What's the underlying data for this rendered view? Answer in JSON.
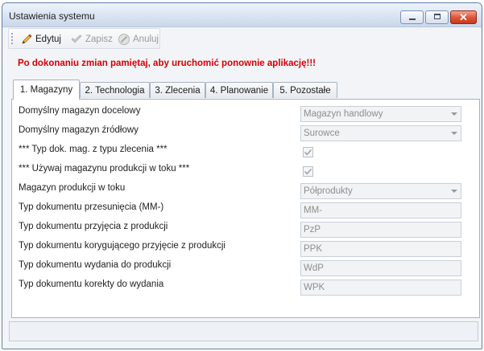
{
  "window": {
    "title": "Ustawienia systemu"
  },
  "toolbar": {
    "edit_label": "Edytuj",
    "save_label": "Zapisz",
    "cancel_label": "Anuluj"
  },
  "warning": "Po dokonaniu zmian pamiętaj, aby uruchomić  ponownie aplikację!!!",
  "tabs": [
    {
      "label": "1. Magazyny",
      "active": true
    },
    {
      "label": "2. Technologia"
    },
    {
      "label": "3. Zlecenia"
    },
    {
      "label": "4. Planowanie"
    },
    {
      "label": "5. Pozostałe"
    }
  ],
  "rows": [
    {
      "label": "Domyślny magazyn docelowy",
      "type": "dropdown",
      "value": "Magazyn handlowy"
    },
    {
      "label": "Domyślny magazyn źródłowy",
      "type": "dropdown",
      "value": "Surowce"
    },
    {
      "label": "*** Typ dok. mag. z typu zlecenia ***",
      "type": "checkbox",
      "checked": true
    },
    {
      "label": "*** Używaj magazynu produkcji w toku ***",
      "type": "checkbox",
      "checked": true
    },
    {
      "label": "Magazyn produkcji w toku",
      "type": "dropdown",
      "value": "Półprodukty"
    },
    {
      "label": "Typ dokumentu przesunięcia (MM-)",
      "type": "text",
      "value": "MM-"
    },
    {
      "label": "Typ dokumentu przyjęcia z produkcji",
      "type": "text",
      "value": "PzP"
    },
    {
      "label": "Typ dokumentu korygującego przyjęcie z produkcji",
      "type": "text",
      "value": "PPK"
    },
    {
      "label": "Typ dokumentu wydania do produkcji",
      "type": "text",
      "value": "WdP"
    },
    {
      "label": "Typ dokumentu korekty do wydania",
      "type": "text",
      "value": "WPK"
    }
  ],
  "colors": {
    "warning": "#d60000",
    "disabled_text": "#8e8e8e",
    "close_button": "#e2553a"
  }
}
